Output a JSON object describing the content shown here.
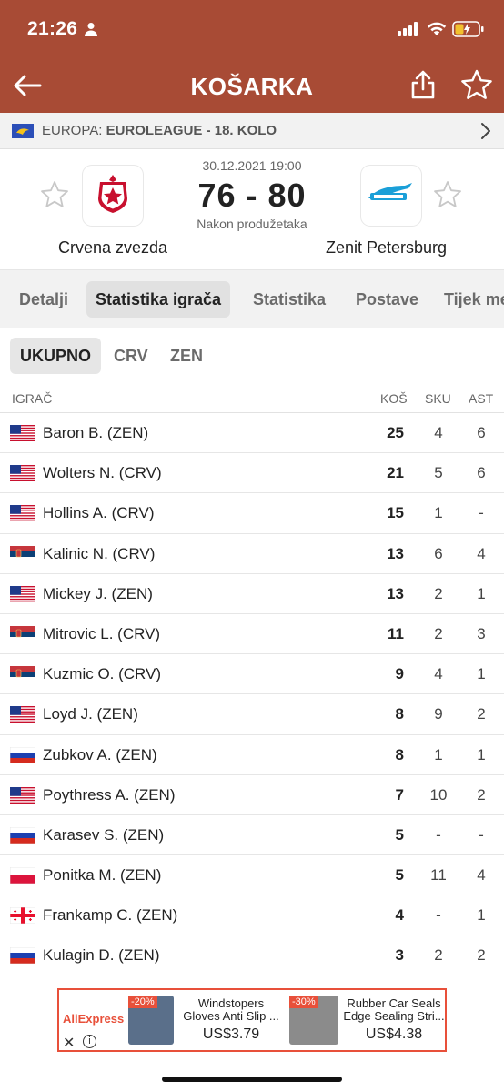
{
  "status": {
    "time": "21:26"
  },
  "header": {
    "title": "KOŠARKA"
  },
  "competition": {
    "region": "EUROPA:",
    "name": "EUROLEAGUE - 18. KOLO"
  },
  "match": {
    "datetime": "30.12.2021 19:00",
    "score": "76 - 80",
    "note": "Nakon produžetaka",
    "home": "Crvena zvezda",
    "away": "Zenit Petersburg"
  },
  "tabs": [
    {
      "label": "Detalji"
    },
    {
      "label": "Statistika igrača"
    },
    {
      "label": "Statistika"
    },
    {
      "label": "Postave"
    },
    {
      "label": "Tijek me"
    }
  ],
  "subtabs": [
    {
      "label": "UKUPNO"
    },
    {
      "label": "CRV"
    },
    {
      "label": "ZEN"
    }
  ],
  "table": {
    "columns": {
      "player": "IGRAČ",
      "pts": "KOŠ",
      "reb": "SKU",
      "ast": "AST"
    },
    "rows": [
      {
        "flag": "us",
        "name": "Baron B. (ZEN)",
        "pts": "25",
        "reb": "4",
        "ast": "6"
      },
      {
        "flag": "us",
        "name": "Wolters N. (CRV)",
        "pts": "21",
        "reb": "5",
        "ast": "6"
      },
      {
        "flag": "us",
        "name": "Hollins A. (CRV)",
        "pts": "15",
        "reb": "1",
        "ast": "-"
      },
      {
        "flag": "rs",
        "name": "Kalinic N. (CRV)",
        "pts": "13",
        "reb": "6",
        "ast": "4"
      },
      {
        "flag": "us",
        "name": "Mickey J. (ZEN)",
        "pts": "13",
        "reb": "2",
        "ast": "1"
      },
      {
        "flag": "rs",
        "name": "Mitrovic L. (CRV)",
        "pts": "11",
        "reb": "2",
        "ast": "3"
      },
      {
        "flag": "rs",
        "name": "Kuzmic O. (CRV)",
        "pts": "9",
        "reb": "4",
        "ast": "1"
      },
      {
        "flag": "us",
        "name": "Loyd J. (ZEN)",
        "pts": "8",
        "reb": "9",
        "ast": "2"
      },
      {
        "flag": "ru",
        "name": "Zubkov A. (ZEN)",
        "pts": "8",
        "reb": "1",
        "ast": "1"
      },
      {
        "flag": "us",
        "name": "Poythress A. (ZEN)",
        "pts": "7",
        "reb": "10",
        "ast": "2"
      },
      {
        "flag": "ru",
        "name": "Karasev S. (ZEN)",
        "pts": "5",
        "reb": "-",
        "ast": "-"
      },
      {
        "flag": "pl",
        "name": "Ponitka M. (ZEN)",
        "pts": "5",
        "reb": "11",
        "ast": "4"
      },
      {
        "flag": "ge",
        "name": "Frankamp C. (ZEN)",
        "pts": "4",
        "reb": "-",
        "ast": "1"
      },
      {
        "flag": "ru",
        "name": "Kulagin D. (ZEN)",
        "pts": "3",
        "reb": "2",
        "ast": "2"
      }
    ]
  },
  "ad": {
    "brand": "AliExpress",
    "item1": {
      "discount": "-20%",
      "title": "Windstopers Gloves Anti Slip ...",
      "price": "US$3.79"
    },
    "item2": {
      "discount": "-30%",
      "title": "Rubber Car Seals Edge Sealing Stri...",
      "price": "US$4.38"
    }
  },
  "colors": {
    "header": "#a84b35",
    "ad_accent": "#e8503a"
  }
}
